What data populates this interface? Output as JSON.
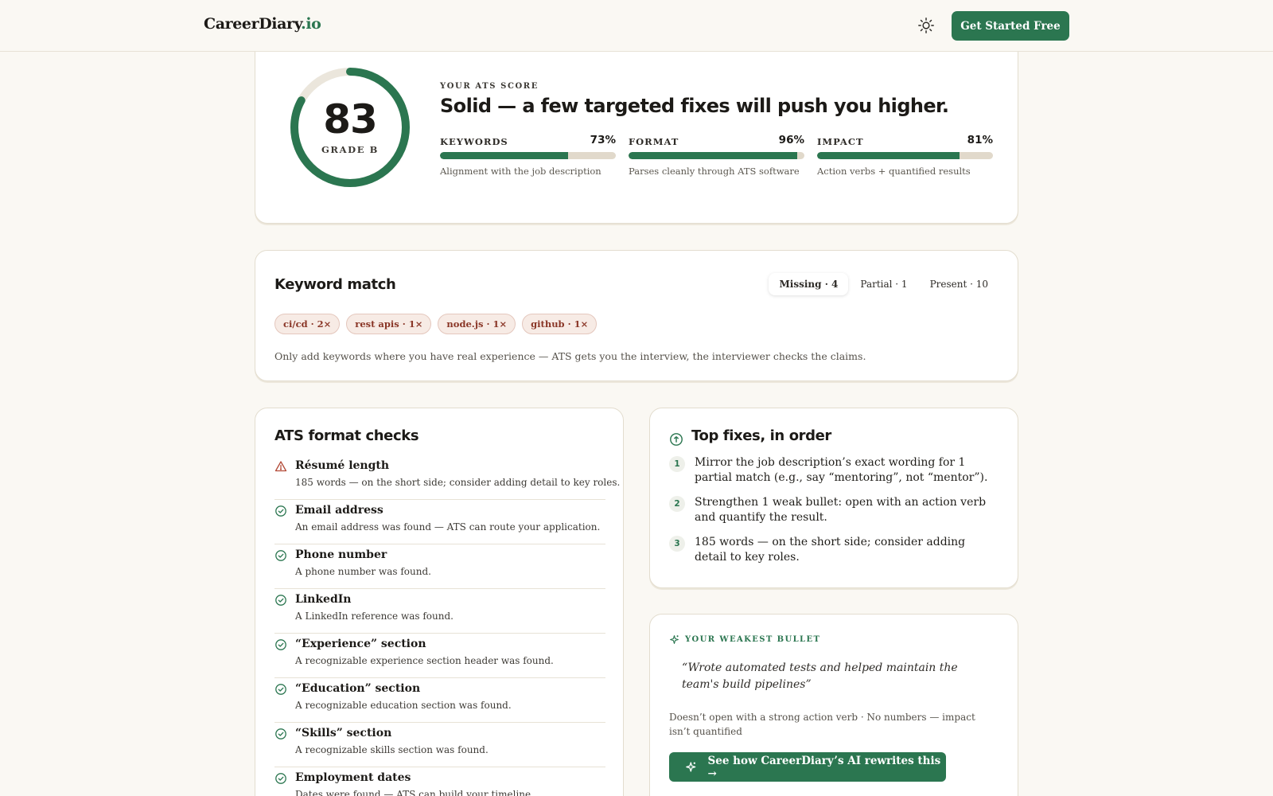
{
  "header": {
    "logo_main": "CareerDiary",
    "logo_tld": ".io",
    "theme_icon": "sun-icon",
    "cta_label": "Get Started Free"
  },
  "score": {
    "value": "83",
    "ring_fraction": 0.83,
    "grade": "GRADE B",
    "eyebrow": "YOUR ATS SCORE",
    "headline": "Solid — a few targeted fixes will push you higher.",
    "metrics": [
      {
        "name": "KEYWORDS",
        "pct": "73%",
        "fill": 0.73,
        "desc": "Alignment with the job description"
      },
      {
        "name": "FORMAT",
        "pct": "96%",
        "fill": 0.96,
        "desc": "Parses cleanly through ATS software"
      },
      {
        "name": "IMPACT",
        "pct": "81%",
        "fill": 0.81,
        "desc": "Action verbs + quantified results"
      }
    ]
  },
  "keywords": {
    "title": "Keyword match",
    "tabs": [
      "Missing · 4",
      "Partial · 1",
      "Present · 10"
    ],
    "active_tab": "Missing · 4",
    "chips": [
      "ci/cd · 2×",
      "rest apis · 1×",
      "node.js · 1×",
      "github · 1×"
    ],
    "note": "Only add keywords where you have real experience — ATS gets you the interview, the interviewer checks the claims."
  },
  "format": {
    "title": "ATS format checks",
    "checks": [
      {
        "label": "Résumé length",
        "desc": "185 words — on the short side; consider adding detail to key roles.",
        "status": "warning"
      },
      {
        "label": "Email address",
        "desc": "An email address was found — ATS can route your application.",
        "status": "pass"
      },
      {
        "label": "Phone number",
        "desc": "A phone number was found.",
        "status": "pass"
      },
      {
        "label": "LinkedIn",
        "desc": "A LinkedIn reference was found.",
        "status": "pass"
      },
      {
        "label": "“Experience” section",
        "desc": "A recognizable experience section header was found.",
        "status": "pass"
      },
      {
        "label": "“Education” section",
        "desc": "A recognizable education section was found.",
        "status": "pass"
      },
      {
        "label": "“Skills” section",
        "desc": "A recognizable skills section was found.",
        "status": "pass"
      },
      {
        "label": "Employment dates",
        "desc": "Dates were found — ATS can build your timeline.",
        "status": "pass"
      }
    ]
  },
  "fixes": {
    "title": "Top fixes, in order",
    "items": [
      {
        "num": "1",
        "text": "Mirror the job description’s exact wording for 1 partial match (e.g., say “mentoring”, not “mentor”)."
      },
      {
        "num": "2",
        "text": "Strengthen 1 weak bullet: open with an action verb and quantify the result."
      },
      {
        "num": "3",
        "text": "185 words — on the short side; consider adding detail to key roles."
      }
    ]
  },
  "bullet": {
    "eyebrow": "YOUR WEAKEST BULLET",
    "quote": "“Wrote automated tests and helped maintain the team's build pipelines”",
    "issues": "Doesn’t open with a strong action verb · No numbers — impact isn’t quantified",
    "cta_label": "See how CareerDiary’s AI rewrites this →"
  },
  "colors": {
    "accent": "#2b7650",
    "background": "#faf8f3",
    "chip_text": "#8a3627",
    "warning": "#b34a37"
  }
}
